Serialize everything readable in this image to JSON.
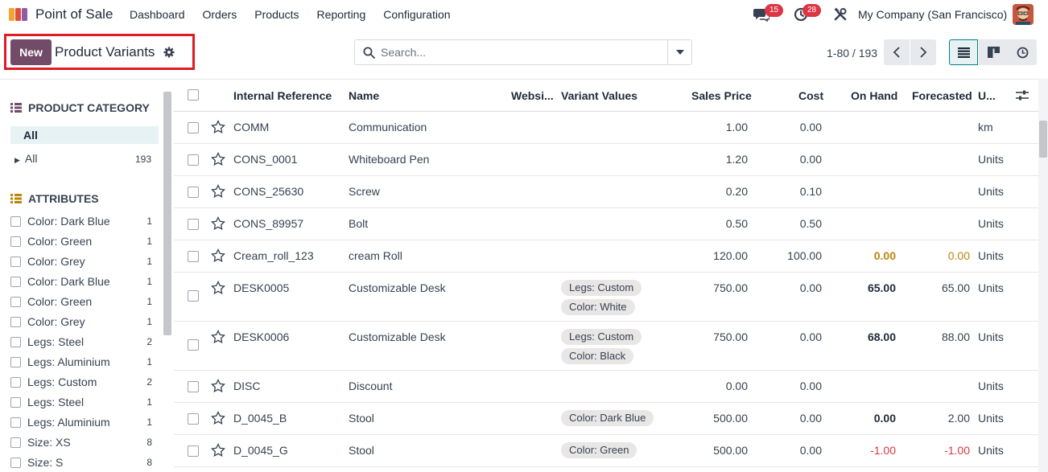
{
  "navbar": {
    "app_name": "Point of Sale",
    "menu": [
      "Dashboard",
      "Orders",
      "Products",
      "Reporting",
      "Configuration"
    ],
    "chat_count": "15",
    "activity_count": "28",
    "company": "My Company (San Francisco)",
    "icons": [
      "chat-icon",
      "clock-icon",
      "tools-icon"
    ]
  },
  "control": {
    "new_label": "New",
    "title": "Product Variants",
    "search_placeholder": "Search...",
    "pager": "1-80 / 193"
  },
  "sidebar": {
    "category_header": "PRODUCT CATEGORY",
    "category_active": "All",
    "category_item": "All",
    "category_count": "193",
    "attributes_header": "ATTRIBUTES",
    "attributes": [
      {
        "label": "Color: Dark Blue",
        "count": "1"
      },
      {
        "label": "Color: Green",
        "count": "1"
      },
      {
        "label": "Color: Grey",
        "count": "1"
      },
      {
        "label": "Color: Dark Blue",
        "count": "1"
      },
      {
        "label": "Color: Green",
        "count": "1"
      },
      {
        "label": "Color: Grey",
        "count": "1"
      },
      {
        "label": "Legs: Steel",
        "count": "2"
      },
      {
        "label": "Legs: Aluminium",
        "count": "1"
      },
      {
        "label": "Legs: Custom",
        "count": "2"
      },
      {
        "label": "Legs: Steel",
        "count": "1"
      },
      {
        "label": "Legs: Aluminium",
        "count": "1"
      },
      {
        "label": "Size: XS",
        "count": "8"
      },
      {
        "label": "Size: S",
        "count": "8"
      }
    ]
  },
  "table": {
    "headers": {
      "ref": "Internal Reference",
      "name": "Name",
      "website": "Websi...",
      "variants": "Variant Values",
      "price": "Sales Price",
      "cost": "Cost",
      "onhand": "On Hand",
      "forecast": "Forecasted",
      "uom": "U..."
    },
    "rows": [
      {
        "ref": "COMM",
        "name": "Communication",
        "tags": [],
        "price": "1.00",
        "cost": "0.00",
        "onhand": "",
        "forecast": "",
        "uom": "km"
      },
      {
        "ref": "CONS_0001",
        "name": "Whiteboard Pen",
        "tags": [],
        "price": "1.20",
        "cost": "0.00",
        "onhand": "",
        "forecast": "",
        "uom": "Units"
      },
      {
        "ref": "CONS_25630",
        "name": "Screw",
        "tags": [],
        "price": "0.20",
        "cost": "0.10",
        "onhand": "",
        "forecast": "",
        "uom": "Units"
      },
      {
        "ref": "CONS_89957",
        "name": "Bolt",
        "tags": [],
        "price": "0.50",
        "cost": "0.50",
        "onhand": "",
        "forecast": "",
        "uom": "Units"
      },
      {
        "ref": "Cream_roll_123",
        "name": "cream Roll",
        "tags": [],
        "price": "120.00",
        "cost": "100.00",
        "onhand": "0.00",
        "forecast": "0.00",
        "uom": "Units",
        "status": "warn"
      },
      {
        "ref": "DESK0005",
        "name": "Customizable Desk",
        "tags": [
          "Legs: Custom",
          "Color: White"
        ],
        "price": "750.00",
        "cost": "0.00",
        "onhand": "65.00",
        "forecast": "65.00",
        "uom": "Units",
        "status": "bold"
      },
      {
        "ref": "DESK0006",
        "name": "Customizable Desk",
        "tags": [
          "Legs: Custom",
          "Color: Black"
        ],
        "price": "750.00",
        "cost": "0.00",
        "onhand": "68.00",
        "forecast": "88.00",
        "uom": "Units",
        "status": "bold"
      },
      {
        "ref": "DISC",
        "name": "Discount",
        "tags": [],
        "price": "0.00",
        "cost": "0.00",
        "onhand": "",
        "forecast": "",
        "uom": "Units"
      },
      {
        "ref": "D_0045_B",
        "name": "Stool",
        "tags": [
          "Color: Dark Blue"
        ],
        "price": "500.00",
        "cost": "0.00",
        "onhand": "0.00",
        "forecast": "2.00",
        "uom": "Units",
        "status": "bold"
      },
      {
        "ref": "D_0045_G",
        "name": "Stool",
        "tags": [
          "Color: Green"
        ],
        "price": "500.00",
        "cost": "0.00",
        "onhand": "-1.00",
        "forecast": "-1.00",
        "uom": "Units",
        "status": "neg"
      }
    ]
  },
  "colors": {
    "brand": "#714b67",
    "highlight": "#e01b24",
    "badge": "#dc3545",
    "warn": "#b7860b",
    "negative": "#d9363e"
  }
}
